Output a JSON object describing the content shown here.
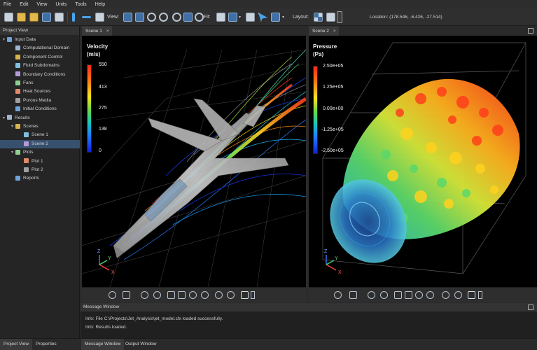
{
  "menu": [
    "File",
    "Edit",
    "View",
    "Units",
    "Tools",
    "Help"
  ],
  "toolbar": {
    "view_label": "View:",
    "fit_label": "Fit:",
    "layout_label": "Layout:",
    "location": "Location:    (178.546, -6.426, -27.514)"
  },
  "project_view": {
    "title": "Project View",
    "tree": [
      {
        "label": "Input Data",
        "level": 0,
        "icon": "input-data-icon",
        "expanded": true
      },
      {
        "label": "Computational Domain",
        "level": 1,
        "icon": "domain-icon"
      },
      {
        "label": "Component Control",
        "level": 1,
        "icon": "component-icon"
      },
      {
        "label": "Fluid Subdomains",
        "level": 1,
        "icon": "fluid-icon"
      },
      {
        "label": "Boundary Conditions",
        "level": 1,
        "icon": "boundary-icon"
      },
      {
        "label": "Fans",
        "level": 1,
        "icon": "fan-icon"
      },
      {
        "label": "Heat Sources",
        "level": 1,
        "icon": "heat-icon"
      },
      {
        "label": "Porous Media",
        "level": 1,
        "icon": "porous-icon"
      },
      {
        "label": "Initial Conditions",
        "level": 1,
        "icon": "initial-icon"
      },
      {
        "label": "Results",
        "level": 0,
        "icon": "results-icon",
        "expanded": true
      },
      {
        "label": "Scenes",
        "level": 1,
        "icon": "scenes-icon",
        "expanded": true
      },
      {
        "label": "Scene 1",
        "level": 2,
        "icon": "scene-icon"
      },
      {
        "label": "Scene 2",
        "level": 2,
        "icon": "scene-icon",
        "selected": true
      },
      {
        "label": "Plots",
        "level": 1,
        "icon": "plots-icon",
        "expanded": true
      },
      {
        "label": "Plot 1",
        "level": 2,
        "icon": "plot-icon"
      },
      {
        "label": "Plot 2",
        "level": 2,
        "icon": "plot-icon"
      },
      {
        "label": "Reports",
        "level": 1,
        "icon": "reports-icon"
      }
    ]
  },
  "scene1": {
    "tab": "Scene 1",
    "close": "×",
    "colorbar": {
      "title1": "Velocity",
      "title2": "(m/s)",
      "ticks": [
        "550",
        "413",
        "275",
        "138",
        "0"
      ]
    },
    "triad": {
      "z": "Z",
      "y": "Y",
      "x": "X"
    }
  },
  "scene2": {
    "tab": "Scene 2",
    "close": "×",
    "colorbar": {
      "title1": "Pressure",
      "title2": "(Pa)",
      "ticks": [
        "2.50e+05",
        "1.25e+05",
        "0.00e+00",
        "-1.25e+05",
        "-2.50e+05"
      ]
    },
    "triad": {
      "z": "Z",
      "y": "Y",
      "x": "X"
    }
  },
  "message_window": {
    "title": "Message Window",
    "lines": [
      "Info: File C:\\Projects\\Jet_Analysis\\jet_model.cfx loaded successfully.",
      "Info: Results loaded."
    ]
  },
  "bottom_tabs": {
    "left": [
      "Project View",
      "Properties"
    ],
    "right": [
      "Message Window",
      "Output Window"
    ]
  },
  "colors": {
    "accent": "#37506e",
    "background": "#2b2b2b",
    "viewport": "#000000"
  }
}
